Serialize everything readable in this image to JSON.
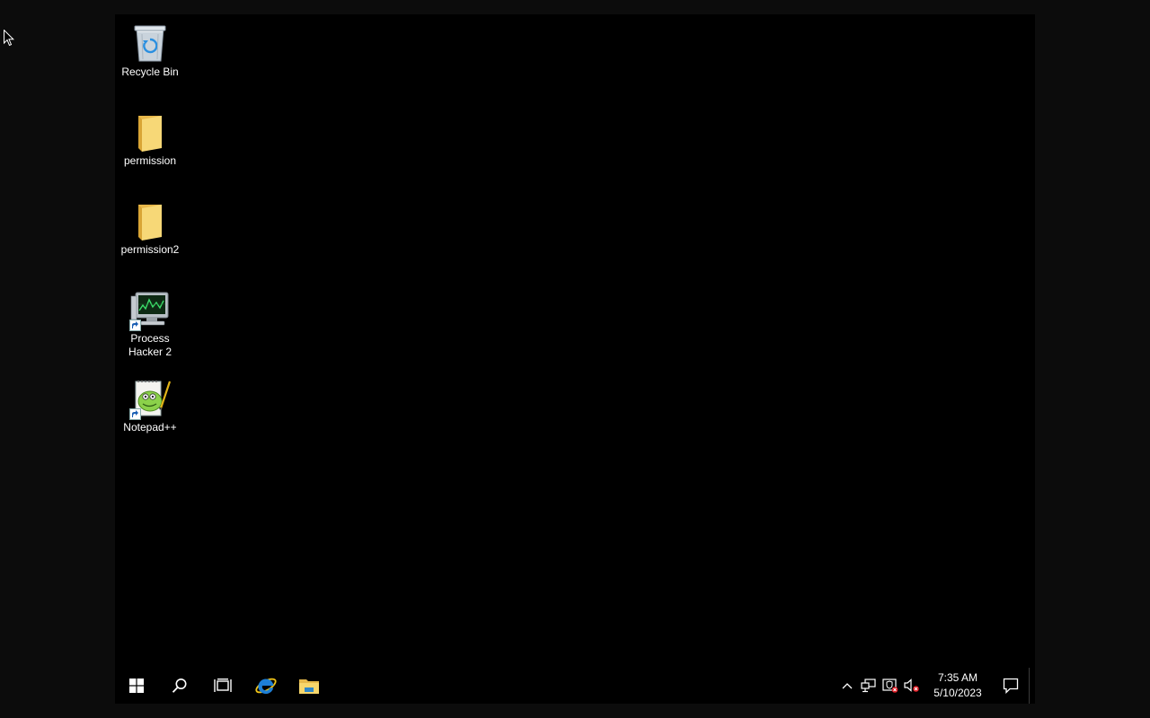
{
  "desktop": {
    "icons": [
      {
        "label": "Recycle Bin",
        "icon": "recycle-bin-icon"
      },
      {
        "label": "permission",
        "icon": "folder-icon"
      },
      {
        "label": "permission2",
        "icon": "folder-icon"
      },
      {
        "label": "Process Hacker 2",
        "icon": "process-hacker-icon"
      },
      {
        "label": "Notepad++",
        "icon": "notepad-plus-plus-icon"
      }
    ]
  },
  "taskbar": {
    "buttons": [
      {
        "name": "start",
        "icon": "windows-logo-icon"
      },
      {
        "name": "search",
        "icon": "search-icon"
      },
      {
        "name": "task-view",
        "icon": "task-view-icon"
      },
      {
        "name": "internet-explorer",
        "icon": "internet-explorer-icon"
      },
      {
        "name": "file-explorer",
        "icon": "file-explorer-icon"
      }
    ],
    "tray": {
      "icons": [
        "chevron-up-icon",
        "network-icon",
        "security-alert-icon",
        "volume-muted-icon"
      ],
      "time": "7:35 AM",
      "date": "5/10/2023",
      "notification_icon": "action-center-icon"
    }
  },
  "colors": {
    "desktop_bg": "#000000",
    "outer_bg": "#0c0c0c",
    "taskbar_bg": "#000000",
    "folder_yellow": "#f5d56a",
    "ie_blue": "#1e7fd6"
  }
}
